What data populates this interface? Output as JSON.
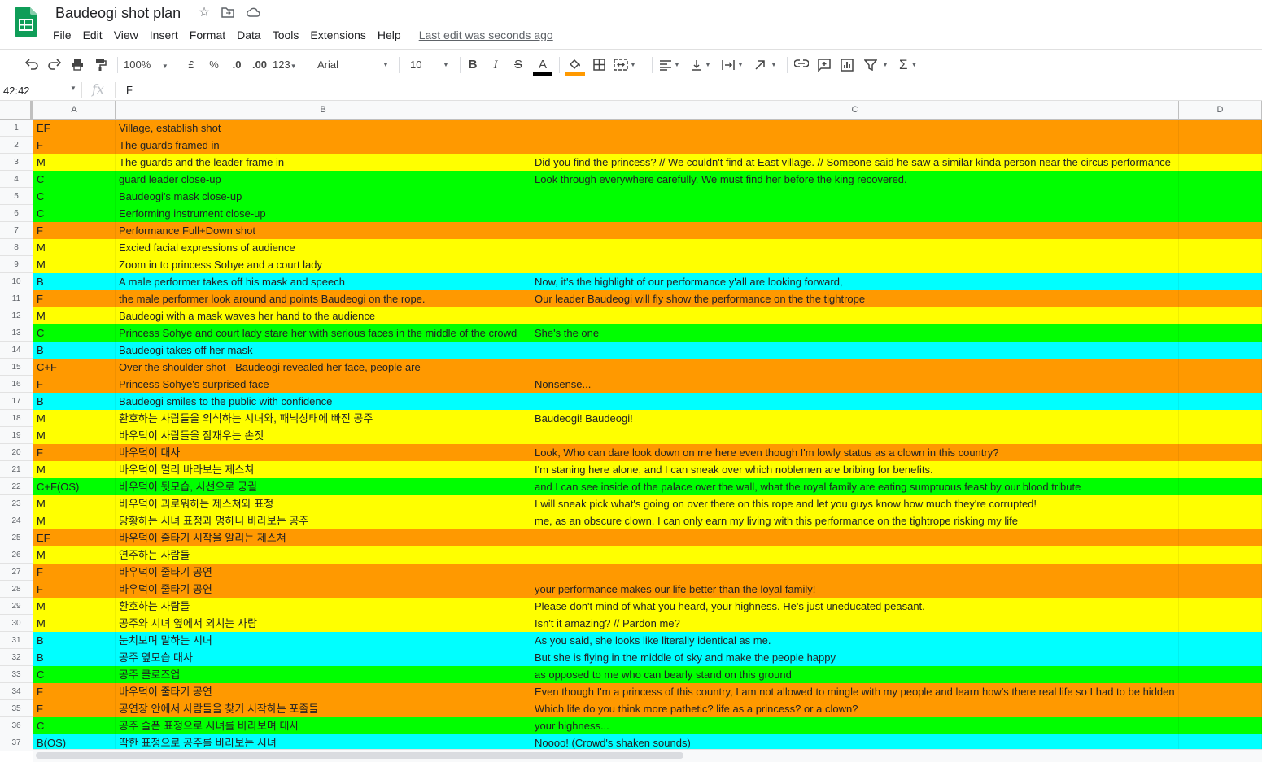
{
  "doc": {
    "title": "Baudeogi shot plan",
    "last_edit": "Last edit was seconds ago"
  },
  "menu": [
    "File",
    "Edit",
    "View",
    "Insert",
    "Format",
    "Data",
    "Tools",
    "Extensions",
    "Help"
  ],
  "toolbar": {
    "zoom": "100%",
    "currency": "£",
    "percent": "%",
    "dec_decrease": ".0",
    "dec_increase": ".00",
    "number_format": "123",
    "font": "Arial",
    "font_size": "10",
    "bold": "B",
    "italic": "I",
    "strike": "S",
    "text_color_letter": "A",
    "sum": "Σ"
  },
  "colors": {
    "orange": "#ff9900",
    "yellow": "#ffff00",
    "green": "#00ff00",
    "cyan": "#00ffff",
    "text_color_bar": "#000000",
    "fill_color_bar": "#ff9900",
    "sheets_green": "#0f9d58"
  },
  "formula_bar": {
    "cell_ref": "42:42",
    "fx": "fx",
    "value": "F"
  },
  "columns": [
    "A",
    "B",
    "C",
    "D"
  ],
  "rows": [
    {
      "n": "1",
      "a": "EF",
      "b": "Village, establish shot",
      "c": "",
      "color": "orange"
    },
    {
      "n": "2",
      "a": "F",
      "b": "The guards framed in",
      "c": "",
      "color": "orange"
    },
    {
      "n": "3",
      "a": "M",
      "b": "The guards and the leader frame in",
      "c": "Did you find the princess? // We couldn't find at East village. // Someone said he saw a similar kinda person near the circus performance",
      "color": "yellow"
    },
    {
      "n": "4",
      "a": "C",
      "b": "guard leader close-up",
      "c": "Look through everywhere carefully. We must find her before the king recovered.",
      "color": "green"
    },
    {
      "n": "5",
      "a": "C",
      "b": "Baudeogi's mask close-up",
      "c": "",
      "color": "green"
    },
    {
      "n": "6",
      "a": "C",
      "b": "Eerforming instrument close-up",
      "c": "",
      "color": "green"
    },
    {
      "n": "7",
      "a": "F",
      "b": "Performance Full+Down shot",
      "c": "",
      "color": "orange"
    },
    {
      "n": "8",
      "a": "M",
      "b": "Excied facial expressions of audience",
      "c": "",
      "color": "yellow"
    },
    {
      "n": "9",
      "a": "M",
      "b": "Zoom in to princess Sohye and a court lady",
      "c": "",
      "color": "yellow"
    },
    {
      "n": "10",
      "a": "B",
      "b": "A male performer takes off his mask and speech",
      "c": "Now, it's the highlight of our performance y'all are looking forward,",
      "color": "cyan"
    },
    {
      "n": "11",
      "a": "F",
      "b": "the male performer look around and points Baudeogi on the rope.",
      "c": "Our leader Baudeogi will fly show the performance on the the tightrope",
      "color": "orange"
    },
    {
      "n": "12",
      "a": "M",
      "b": "Baudeogi with a mask waves her hand to the audience",
      "c": "",
      "color": "yellow"
    },
    {
      "n": "13",
      "a": "C",
      "b": "Princess Sohye and court lady stare her with serious faces in the middle of the crowd",
      "c": "She's the one",
      "color": "green"
    },
    {
      "n": "14",
      "a": "B",
      "b": "Baudeogi takes off her mask",
      "c": "",
      "color": "cyan"
    },
    {
      "n": "15",
      "a": "C+F",
      "b": "Over the shoulder shot - Baudeogi revealed her face, people are",
      "c": "",
      "color": "orange"
    },
    {
      "n": "16",
      "a": "F",
      "b": "Princess Sohye's surprised face",
      "c": "Nonsense...",
      "color": "orange"
    },
    {
      "n": "17",
      "a": "B",
      "b": "Baudeogi smiles to the public with confidence",
      "c": "",
      "color": "cyan"
    },
    {
      "n": "18",
      "a": "M",
      "b": "환호하는 사람들을 의식하는 시녀와, 패닉상태에 빠진 공주",
      "c": "Baudeogi! Baudeogi!",
      "color": "yellow"
    },
    {
      "n": "19",
      "a": "M",
      "b": "바우덕이 사람들을 잠재우는 손짓",
      "c": "",
      "color": "yellow"
    },
    {
      "n": "20",
      "a": "F",
      "b": "바우덕이 대사",
      "c": "Look, Who can dare look down on me here even though I'm  lowly status as a clown in this country?",
      "color": "orange"
    },
    {
      "n": "21",
      "a": "M",
      "b": "바우덕이 멀리 바라보는 제스쳐",
      "c": "I'm staning here alone, and I can sneak over which noblemen are bribing for benefits.",
      "color": "yellow"
    },
    {
      "n": "22",
      "a": "C+F(OS)",
      "b": "바우덕이 뒷모습, 시선으로 궁궐",
      "c": "and I can see inside of the palace over the wall, what the royal family are eating sumptuous feast by our blood tribute",
      "color": "green"
    },
    {
      "n": "23",
      "a": "M",
      "b": " 바우덕이 괴로워하는 제스쳐와 표정",
      "c": "I will sneak pick what's going on over there on this rope and let you guys know how much they're corrupted!",
      "color": "yellow"
    },
    {
      "n": "24",
      "a": "M",
      "b": "당황하는 시녀 표정과 멍하니 바라보는 공주",
      "c": "me, as an obscure clown, I can only earn my living with this performance on the tightrope risking my life",
      "color": "yellow"
    },
    {
      "n": "25",
      "a": "EF",
      "b": "바우덕이 줄타기 시작을 알리는 제스쳐",
      "c": "",
      "color": "orange"
    },
    {
      "n": "26",
      "a": "M",
      "b": "연주하는 사람들",
      "c": "",
      "color": "yellow"
    },
    {
      "n": "27",
      "a": "F",
      "b": "바우덕이 줄타기 공연",
      "c": "",
      "color": "orange"
    },
    {
      "n": "28",
      "a": "F",
      "b": "바우덕이 줄타기 공연",
      "c": "your performance makes our life better than the loyal family!",
      "color": "orange"
    },
    {
      "n": "29",
      "a": "M",
      "b": "환호하는 사람들",
      "c": "Please don't mind of what you heard, your highness. He's just uneducated peasant.",
      "color": "yellow"
    },
    {
      "n": "30",
      "a": "M",
      "b": "공주와 시녀 옆에서 외치는 사람",
      "c": "Isn't it amazing? // Pardon me?",
      "color": "yellow"
    },
    {
      "n": "31",
      "a": "B",
      "b": "눈치보며 말하는 시녀",
      "c": "As you said, she looks like literally identical as me.",
      "color": "cyan"
    },
    {
      "n": "32",
      "a": "B",
      "b": "공주 옆모습 대사",
      "c": "But she is flying in the middle of sky and make the people happy",
      "color": "cyan"
    },
    {
      "n": "33",
      "a": "C",
      "b": "공주 클로즈업",
      "c": "as opposed to me who can bearly stand on this ground",
      "color": "green"
    },
    {
      "n": "34",
      "a": "F",
      "b": " 바우덕이 줄타기 공연",
      "c": "Even though I'm a princess of this country, I am not allowed to mingle with my people and learn how's there real life so I had to be hidden for this.",
      "color": "orange"
    },
    {
      "n": "35",
      "a": "F",
      "b": "공연장 안에서 사람들을 찾기 시작하는 포졸들",
      "c": "Which life do you think more pathetic? life as a princess? or a clown?",
      "color": "orange"
    },
    {
      "n": "36",
      "a": "C",
      "b": "공주 슬픈 표정으로 시녀를 바라보며 대사",
      "c": "your highness...",
      "color": "green"
    },
    {
      "n": "37",
      "a": "B(OS)",
      "b": "딱한 표정으로 공주를 바라보는 시녀",
      "c": "Noooo! (Crowd's shaken sounds)",
      "color": "cyan"
    }
  ]
}
